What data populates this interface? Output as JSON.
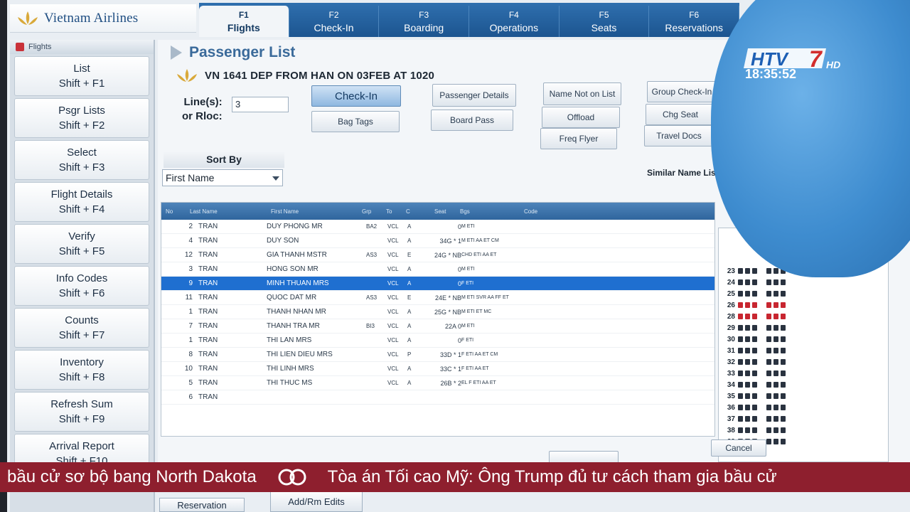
{
  "airline": {
    "name": "Vietnam Airlines"
  },
  "tabs": [
    {
      "key": "F1",
      "label": "Flights"
    },
    {
      "key": "F2",
      "label": "Check-In"
    },
    {
      "key": "F3",
      "label": "Boarding"
    },
    {
      "key": "F4",
      "label": "Operations"
    },
    {
      "key": "F5",
      "label": "Seats"
    },
    {
      "key": "F6",
      "label": "Reservations"
    }
  ],
  "sidebar": {
    "header": "Flights",
    "items": [
      {
        "label": "List",
        "shortcut": "Shift + F1"
      },
      {
        "label": "Psgr Lists",
        "shortcut": "Shift + F2"
      },
      {
        "label": "Select",
        "shortcut": "Shift + F3"
      },
      {
        "label": "Flight Details",
        "shortcut": "Shift + F4"
      },
      {
        "label": "Verify",
        "shortcut": "Shift + F5"
      },
      {
        "label": "Info Codes",
        "shortcut": "Shift + F6"
      },
      {
        "label": "Counts",
        "shortcut": "Shift + F7"
      },
      {
        "label": "Inventory",
        "shortcut": "Shift + F8"
      },
      {
        "label": "Refresh Sum",
        "shortcut": "Shift + F9"
      },
      {
        "label": "Arrival Report",
        "shortcut": "Shift + F10"
      }
    ]
  },
  "main": {
    "title": "Passenger List",
    "flight_info": "VN 1641  DEP FROM HAN  ON 03FEB AT 1020",
    "lines_label_1": "Line(s):",
    "lines_label_2": "or Rloc:",
    "lines_value": "3",
    "buttons": {
      "check_in": "Check-In",
      "bag_tags": "Bag Tags",
      "passenger_details": "Passenger Details",
      "board_pass": "Board Pass",
      "name_not_on_list": "Name Not on List",
      "offload": "Offload",
      "freq_flyer": "Freq Flyer",
      "group_check_in": "Group Check-In",
      "chg_seat": "Chg Seat",
      "travel_docs": "Travel Docs",
      "cancel": "Cancel"
    },
    "sort_by_label": "Sort By",
    "sort_by_value": "First Name",
    "similar_label": "Similar Name List"
  },
  "table": {
    "headers": [
      "No",
      "Last Name",
      "First Name",
      "Grp",
      "To",
      "C",
      "Seat",
      "Bgs",
      "Code"
    ],
    "rows": [
      {
        "no": "2",
        "last": "TRAN",
        "first": "DUY PHONG MR",
        "grp": "BA2",
        "to": "VCL",
        "c": "A",
        "seat": "0",
        "code": "M ETI"
      },
      {
        "no": "4",
        "last": "TRAN",
        "first": "DUY SON",
        "grp": "",
        "to": "VCL",
        "c": "A",
        "seat": "34G * 1",
        "code": "M ETI AA ET CM"
      },
      {
        "no": "12",
        "last": "TRAN",
        "first": "GIA THANH MSTR",
        "grp": "AS3",
        "to": "VCL",
        "c": "E",
        "seat": "24G * NB",
        "code": "CHD ETI AA ET"
      },
      {
        "no": "3",
        "last": "TRAN",
        "first": "HONG SON MR",
        "grp": "",
        "to": "VCL",
        "c": "A",
        "seat": "0",
        "code": "M ETI"
      },
      {
        "no": "9",
        "last": "TRAN",
        "first": "MINH THUAN MRS",
        "grp": "",
        "to": "VCL",
        "c": "A",
        "seat": "0",
        "code": "F ETI",
        "selected": true
      },
      {
        "no": "11",
        "last": "TRAN",
        "first": "QUOC DAT MR",
        "grp": "AS3",
        "to": "VCL",
        "c": "E",
        "seat": "24E * NB",
        "code": "M ETI SVR AA FF ET"
      },
      {
        "no": "1",
        "last": "TRAN",
        "first": "THANH NHAN MR",
        "grp": "",
        "to": "VCL",
        "c": "A",
        "seat": "25G * NB",
        "code": "M ETI ET MC"
      },
      {
        "no": "7",
        "last": "TRAN",
        "first": "THANH TRA MR",
        "grp": "BI3",
        "to": "VCL",
        "c": "A",
        "seat": "22A 0",
        "code": "M ETI"
      },
      {
        "no": "1",
        "last": "TRAN",
        "first": "THI LAN MRS",
        "grp": "",
        "to": "VCL",
        "c": "A",
        "seat": "0",
        "code": "F ETI"
      },
      {
        "no": "8",
        "last": "TRAN",
        "first": "THI LIEN DIEU MRS",
        "grp": "",
        "to": "VCL",
        "c": "P",
        "seat": "33D * 1",
        "code": "F ETI AA ET CM"
      },
      {
        "no": "10",
        "last": "TRAN",
        "first": "THI LINH MRS",
        "grp": "",
        "to": "VCL",
        "c": "A",
        "seat": "33C * 1",
        "code": "F ETI AA ET"
      },
      {
        "no": "5",
        "last": "TRAN",
        "first": "THI THUC MS",
        "grp": "",
        "to": "VCL",
        "c": "A",
        "seat": "26B * 2",
        "code": "EL F ETI AA ET"
      },
      {
        "no": "6",
        "last": "TRAN",
        "first": "",
        "grp": "",
        "to": "",
        "c": "",
        "seat": "",
        "code": ""
      }
    ]
  },
  "seatmap": {
    "rows": [
      "23",
      "24",
      "25",
      "26",
      "28",
      "29",
      "30",
      "31",
      "32",
      "33",
      "34",
      "35",
      "36",
      "37",
      "38",
      "39"
    ],
    "right_rows": [
      "23",
      "24",
      "25",
      "26",
      "29",
      "32",
      "33",
      "34",
      "35",
      "36",
      "37",
      "38",
      "39"
    ]
  },
  "bottom_tabs": {
    "add_rm_edits": "Add/Rm Edits",
    "reservation": "Reservation"
  },
  "broadcast": {
    "channel": "HTV7",
    "time": "18:35:52",
    "ticker_1": "bầu cử sơ bộ bang North Dakota",
    "ticker_2": "Tòa án Tối cao Mỹ: Ông Trump đủ tư cách tham gia bầu cử"
  },
  "colors": {
    "brand_blue": "#1f4e82",
    "selected_row": "#1f6fd0",
    "occupied_seat": "#c82630",
    "ticker": "#8e1f2e"
  }
}
